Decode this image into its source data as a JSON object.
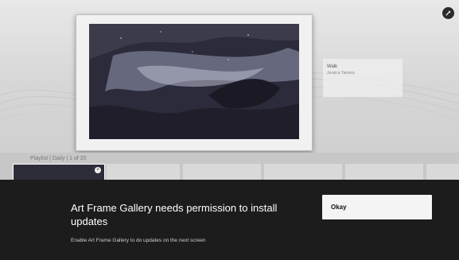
{
  "background": {
    "info_card": {
      "title": "Walk",
      "subtitle": "Jessica Tamara"
    },
    "playlist_label": "Playlist  |  Daily  |  1 of 20"
  },
  "dialog": {
    "title": "Art Frame Gallery needs permission to install updates",
    "description": "Enable Art Frame Gallery to do updates on the next screen",
    "okay_label": "Okay"
  },
  "icons": {
    "corner": "settings-icon",
    "thumb_close": "close-icon"
  },
  "colors": {
    "dialog_bg": "#1c1c1c",
    "button_bg": "#f4f4f4",
    "backdrop": "#dcdcdc"
  }
}
